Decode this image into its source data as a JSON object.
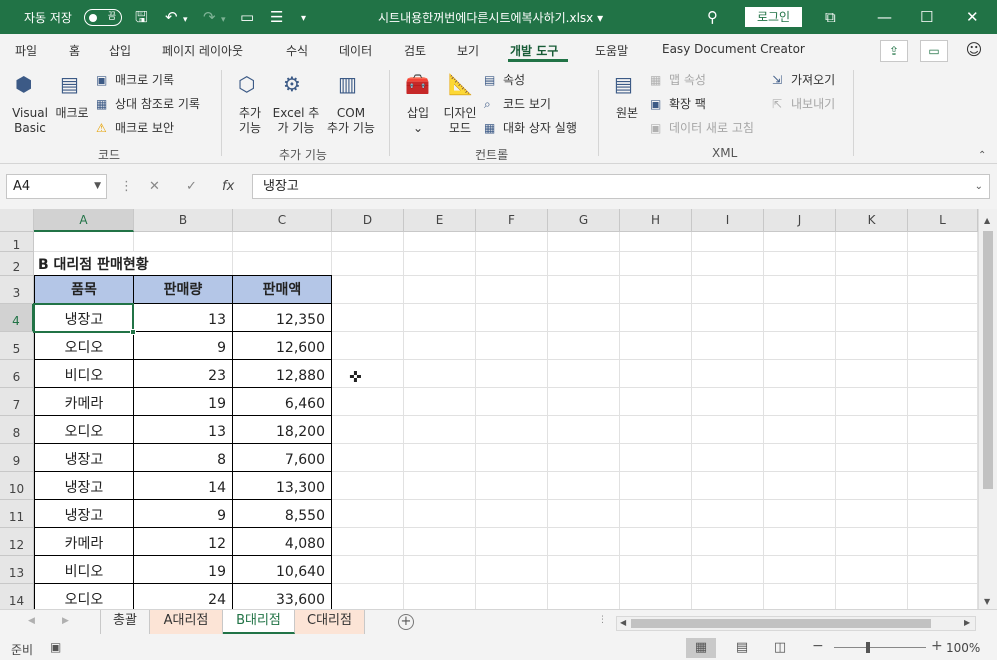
{
  "titlebar": {
    "autosave_label": "자동 저장",
    "autosave_state": "끔",
    "filename": "시트내용한꺼번에다른시트에복사하기.xlsx",
    "filename_dropdown": "▾",
    "login_label": "로그인",
    "icons": [
      "save-icon",
      "undo-icon",
      "redo-icon",
      "new-icon",
      "layout-icon",
      "customize-icon",
      "search-icon",
      "ribbon-display-icon",
      "minimize-icon",
      "restore-icon",
      "close-icon"
    ]
  },
  "menu": {
    "tabs": [
      "파일",
      "홈",
      "삽입",
      "페이지 레이아웃",
      "수식",
      "데이터",
      "검토",
      "보기",
      "개발 도구",
      "도움말",
      "Easy Document Creator"
    ],
    "active": "개발 도구"
  },
  "ribbon": {
    "code": {
      "visual_basic_line1": "Visual",
      "visual_basic_line2": "Basic",
      "macro": "매크로",
      "record_macro": "매크로 기록",
      "relative_ref": "상대 참조로 기록",
      "macro_security": "매크로 보안",
      "group_label": "코드"
    },
    "addins": {
      "addins_line1": "추가",
      "addins_line2": "기능",
      "excel_addins_line1": "Excel 추",
      "excel_addins_line2": "가 기능",
      "com_addins_line1": "COM",
      "com_addins_line2": "추가 기능",
      "group_label": "추가 기능"
    },
    "controls": {
      "insert": "삽입",
      "design_mode_line1": "디자인",
      "design_mode_line2": "모드",
      "properties": "속성",
      "view_code": "코드 보기",
      "run_dialog": "대화 상자 실행",
      "group_label": "컨트롤"
    },
    "xml": {
      "source": "원본",
      "map_properties": "맵 속성",
      "expansion_packs": "확장 팩",
      "refresh_data": "데이터 새로 고침",
      "import": "가져오기",
      "export": "내보내기",
      "group_label": "XML"
    }
  },
  "formula_bar": {
    "name_box": "A4",
    "fx": "fx",
    "content": "냉장고"
  },
  "grid": {
    "columns": [
      "A",
      "B",
      "C",
      "D",
      "E",
      "F",
      "G",
      "H",
      "I",
      "J",
      "K",
      "L"
    ],
    "rows": [
      "1",
      "2",
      "3",
      "4",
      "5",
      "6",
      "7",
      "8",
      "9",
      "10",
      "11",
      "12",
      "13",
      "14"
    ],
    "title": "B 대리점 판매현황",
    "headers": [
      "품목",
      "판매량",
      "판매액"
    ],
    "data": [
      [
        "냉장고",
        "13",
        "12,350"
      ],
      [
        "오디오",
        "9",
        "12,600"
      ],
      [
        "비디오",
        "23",
        "12,880"
      ],
      [
        "카메라",
        "19",
        "6,460"
      ],
      [
        "오디오",
        "13",
        "18,200"
      ],
      [
        "냉장고",
        "8",
        "7,600"
      ],
      [
        "냉장고",
        "14",
        "13,300"
      ],
      [
        "냉장고",
        "9",
        "8,550"
      ],
      [
        "카메라",
        "12",
        "4,080"
      ],
      [
        "비디오",
        "19",
        "10,640"
      ],
      [
        "오디오",
        "24",
        "33,600"
      ]
    ]
  },
  "sheets": {
    "tabs": [
      "총괄",
      "A대리점",
      "B대리점",
      "C대리점"
    ],
    "active": "B대리점",
    "add": "+"
  },
  "status": {
    "text": "준비",
    "zoom": "100%",
    "zoom_minus": "−",
    "zoom_plus": "+"
  },
  "colors": {
    "excel_green": "#217346",
    "header_fill": "#b4c6e7",
    "tab_peach": "#fce4d6"
  }
}
